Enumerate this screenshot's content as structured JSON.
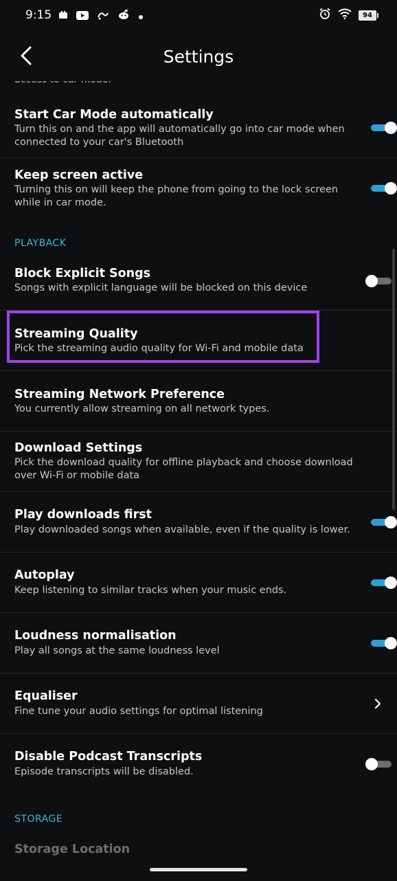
{
  "status_bar": {
    "time": "9:15",
    "battery": "94",
    "left_icons": [
      "cast-icon",
      "youtube-icon",
      "app-icon",
      "reddit-icon",
      "dot-icon"
    ],
    "right_icons": [
      "alarm-icon",
      "wifi-icon",
      "battery-icon"
    ]
  },
  "header": {
    "title": "Settings",
    "back_icon": "back-arrow-icon"
  },
  "clipped_text": "access to car mode.",
  "rows": [
    {
      "title": "Start Car Mode automatically",
      "subtitle": "Turn this on and the app will automatically go into car mode when connected to your car's Bluetooth",
      "control": "toggle",
      "state": "on"
    },
    {
      "title": "Keep screen active",
      "subtitle": "Turning this on will keep the phone from going to the lock screen while in car mode.",
      "control": "toggle",
      "state": "on"
    },
    {
      "title": "Block Explicit Songs",
      "subtitle": "Songs with explicit language will be blocked on this device",
      "control": "toggle",
      "state": "off"
    },
    {
      "title": "Streaming Quality",
      "subtitle": "Pick the streaming audio quality for Wi-Fi and mobile data",
      "control": "none"
    },
    {
      "title": "Streaming Network Preference",
      "subtitle": "You currently allow streaming on all network types.",
      "control": "none"
    },
    {
      "title": "Download Settings",
      "subtitle": "Pick the download quality for offline playback and choose download over Wi-Fi or mobile data",
      "control": "none"
    },
    {
      "title": "Play downloads first",
      "subtitle": "Play downloaded songs when available, even if the quality is lower.",
      "control": "toggle",
      "state": "on"
    },
    {
      "title": "Autoplay",
      "subtitle": "Keep listening to similar tracks when your music ends.",
      "control": "toggle",
      "state": "on"
    },
    {
      "title": "Loudness normalisation",
      "subtitle": "Play all songs at the same loudness level",
      "control": "toggle",
      "state": "on"
    },
    {
      "title": "Equaliser",
      "subtitle": "Fine tune your audio settings for optimal listening",
      "control": "chevron"
    },
    {
      "title": "Disable Podcast Transcripts",
      "subtitle": "Episode transcripts will be disabled.",
      "control": "toggle",
      "state": "off"
    }
  ],
  "sections": {
    "playback": "PLAYBACK",
    "storage": "STORAGE"
  },
  "partial_row": "Storage Location",
  "colors": {
    "background": "#0e0f10",
    "accent": "#3bb6e0",
    "toggle_on": "#2f9fd4",
    "highlight": "#a43ff0"
  }
}
